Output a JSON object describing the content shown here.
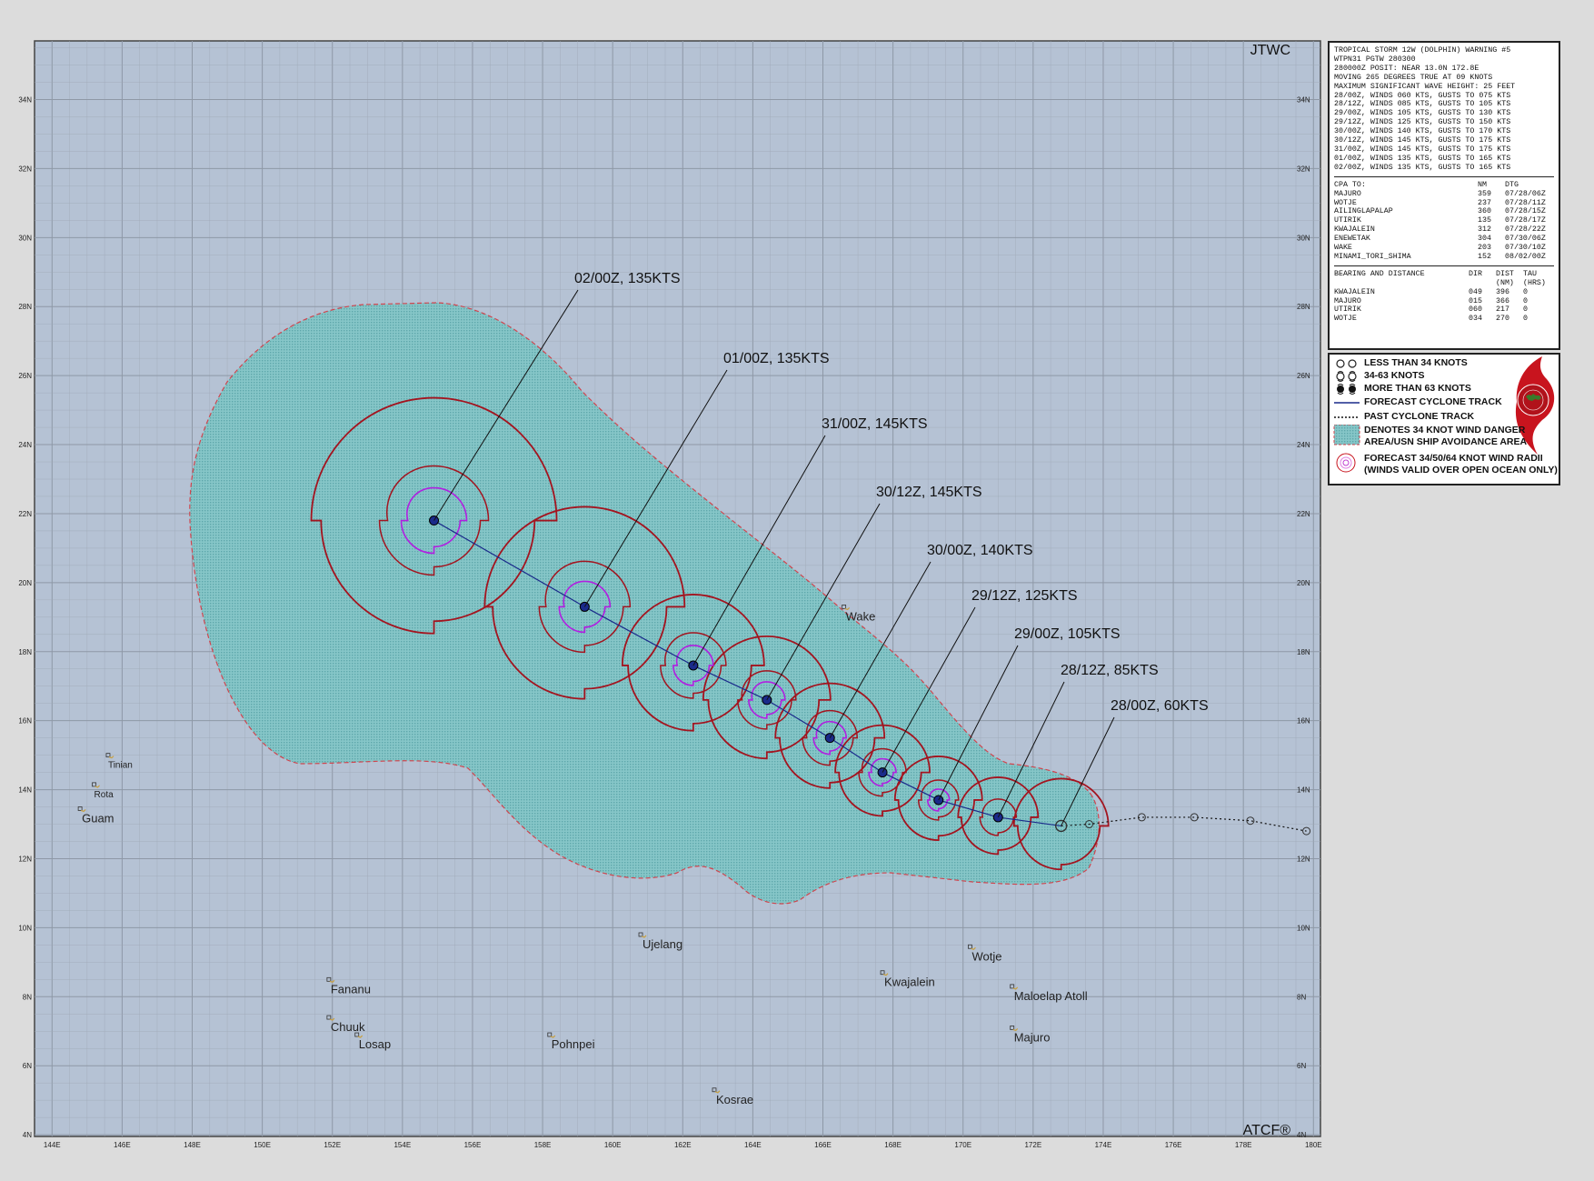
{
  "map": {
    "agency_label": "JTWC",
    "software_label": "ATCF®",
    "lon_labels": [
      "144E",
      "146E",
      "148E",
      "150E",
      "152E",
      "154E",
      "156E",
      "158E",
      "160E",
      "162E",
      "164E",
      "166E",
      "168E",
      "170E",
      "172E",
      "174E",
      "176E",
      "178E",
      "180E"
    ],
    "lat_labels": [
      "4N",
      "6N",
      "8N",
      "10N",
      "12N",
      "14N",
      "16N",
      "18N",
      "20N",
      "22N",
      "24N",
      "26N",
      "28N",
      "30N",
      "32N",
      "34N"
    ],
    "forecast_labels": [
      {
        "text": "28/00Z,  60KTS",
        "lat": 12.95,
        "lon": 172.8
      },
      {
        "text": "28/12Z,  85KTS",
        "lat": 13.2,
        "lon": 171.0
      },
      {
        "text": "29/00Z, 105KTS",
        "lat": 13.7,
        "lon": 169.3
      },
      {
        "text": "29/12Z, 125KTS",
        "lat": 14.5,
        "lon": 167.7
      },
      {
        "text": "30/00Z, 140KTS",
        "lat": 15.5,
        "lon": 166.2
      },
      {
        "text": "30/12Z, 145KTS",
        "lat": 16.6,
        "lon": 164.4
      },
      {
        "text": "31/00Z, 145KTS",
        "lat": 17.6,
        "lon": 162.3
      },
      {
        "text": "01/00Z, 135KTS",
        "lat": 19.3,
        "lon": 159.2
      },
      {
        "text": "02/00Z, 135KTS",
        "lat": 21.8,
        "lon": 154.9
      }
    ],
    "forecast_track": [
      {
        "lat": 12.95,
        "lon": 172.8
      },
      {
        "lat": 13.2,
        "lon": 171.0
      },
      {
        "lat": 13.7,
        "lon": 169.3
      },
      {
        "lat": 14.5,
        "lon": 167.7
      },
      {
        "lat": 15.5,
        "lon": 166.2
      },
      {
        "lat": 16.6,
        "lon": 164.4
      },
      {
        "lat": 17.6,
        "lon": 162.3
      },
      {
        "lat": 19.3,
        "lon": 159.2
      },
      {
        "lat": 21.8,
        "lon": 154.9
      }
    ],
    "past_track": [
      {
        "lat": 12.95,
        "lon": 172.8
      },
      {
        "lat": 13.0,
        "lon": 173.6
      },
      {
        "lat": 13.2,
        "lon": 175.1
      },
      {
        "lat": 13.2,
        "lon": 176.6
      },
      {
        "lat": 13.1,
        "lon": 178.2
      },
      {
        "lat": 12.8,
        "lon": 179.8
      }
    ],
    "places": [
      {
        "name": "Wake",
        "lat": 19.3,
        "lon": 166.6
      },
      {
        "name": "Ujelang",
        "lat": 9.8,
        "lon": 160.8
      },
      {
        "name": "Wotje",
        "lat": 9.45,
        "lon": 170.2
      },
      {
        "name": "Kwajalein",
        "lat": 8.7,
        "lon": 167.7
      },
      {
        "name": "Maloelap Atoll",
        "lat": 8.3,
        "lon": 171.4
      },
      {
        "name": "Majuro",
        "lat": 7.1,
        "lon": 171.4
      },
      {
        "name": "Pohnpei",
        "lat": 6.9,
        "lon": 158.2
      },
      {
        "name": "Kosrae",
        "lat": 5.3,
        "lon": 162.9
      },
      {
        "name": "Fananu",
        "lat": 8.5,
        "lon": 151.9
      },
      {
        "name": "Chuuk",
        "lat": 7.4,
        "lon": 151.9
      },
      {
        "name": "Losap",
        "lat": 6.9,
        "lon": 152.7
      },
      {
        "name": "Tinian",
        "lat": 15.0,
        "lon": 145.6
      },
      {
        "name": "Rota",
        "lat": 14.15,
        "lon": 145.2
      },
      {
        "name": "Guam",
        "lat": 13.45,
        "lon": 144.8
      }
    ]
  },
  "warning": {
    "header": [
      "TROPICAL STORM 12W (DOLPHIN) WARNING #5",
      "WTPN31 PGTW 280300",
      "280000Z POSIT: NEAR 13.0N 172.8E",
      "MOVING 265 DEGREES TRUE AT 09 KNOTS",
      "MAXIMUM SIGNIFICANT WAVE HEIGHT: 25 FEET",
      "28/00Z, WINDS 060 KTS, GUSTS TO 075 KTS",
      "28/12Z, WINDS 085 KTS, GUSTS TO 105 KTS",
      "29/00Z, WINDS 105 KTS, GUSTS TO 130 KTS",
      "29/12Z, WINDS 125 KTS, GUSTS TO 150 KTS",
      "30/00Z, WINDS 140 KTS, GUSTS TO 170 KTS",
      "30/12Z, WINDS 145 KTS, GUSTS TO 175 KTS",
      "31/00Z, WINDS 145 KTS, GUSTS TO 175 KTS",
      "01/00Z, WINDS 135 KTS, GUSTS TO 165 KTS",
      "02/00Z, WINDS 135 KTS, GUSTS TO 165 KTS"
    ],
    "cpa_headers": [
      "CPA TO:",
      "NM",
      "DTG"
    ],
    "cpa_rows": [
      [
        "MAJURO",
        "359",
        "07/28/06Z"
      ],
      [
        "WOTJE",
        "237",
        "07/28/11Z"
      ],
      [
        "AILINGLAPALAP",
        "360",
        "07/28/15Z"
      ],
      [
        "UTIRIK",
        "135",
        "07/28/17Z"
      ],
      [
        "KWAJALEIN",
        "312",
        "07/28/22Z"
      ],
      [
        "ENEWETAK",
        "304",
        "07/30/06Z"
      ],
      [
        "WAKE",
        "203",
        "07/30/10Z"
      ],
      [
        "MINAMI_TORI_SHIMA",
        "152",
        "08/02/00Z"
      ]
    ],
    "bearing_headers": [
      "BEARING AND DISTANCE",
      "DIR",
      "DIST",
      "TAU"
    ],
    "bearing_subheaders": [
      "",
      "",
      "(NM)",
      "(HRS)"
    ],
    "bearing_rows": [
      [
        "KWAJALEIN",
        "049",
        "396",
        "0"
      ],
      [
        "MAJURO",
        "015",
        "366",
        "0"
      ],
      [
        "UTIRIK",
        "060",
        "217",
        "0"
      ],
      [
        "WOTJE",
        "034",
        "270",
        "0"
      ]
    ]
  },
  "legend": {
    "items": [
      {
        "icon": "less-than-34-knots-icon",
        "text": "LESS THAN 34 KNOTS"
      },
      {
        "icon": "34-63-knots-icon",
        "text": "34-63 KNOTS"
      },
      {
        "icon": "more-than-63-knots-icon",
        "text": "MORE THAN 63 KNOTS"
      },
      {
        "icon": "forecast-track-icon",
        "text": "FORECAST CYCLONE TRACK"
      },
      {
        "icon": "past-track-icon",
        "text": "PAST CYCLONE TRACK"
      },
      {
        "icon": "danger-area-icon",
        "text": "DENOTES 34 KNOT WIND DANGER\nAREA/USN SHIP AVOIDANCE AREA"
      },
      {
        "icon": "wind-radii-icon",
        "text": "FORECAST 34/50/64 KNOT WIND RADII\n(WINDS VALID OVER OPEN OCEAN ONLY)"
      }
    ]
  },
  "colors": {
    "ocean": "#b5c2d4",
    "grid": "#8e98a6",
    "danger": "#7ec3c3",
    "danger_edge": "#d0454e",
    "r34": "#a3141f",
    "r64": "#b020e0",
    "track": "#1a2a8a",
    "text": "#111111"
  }
}
